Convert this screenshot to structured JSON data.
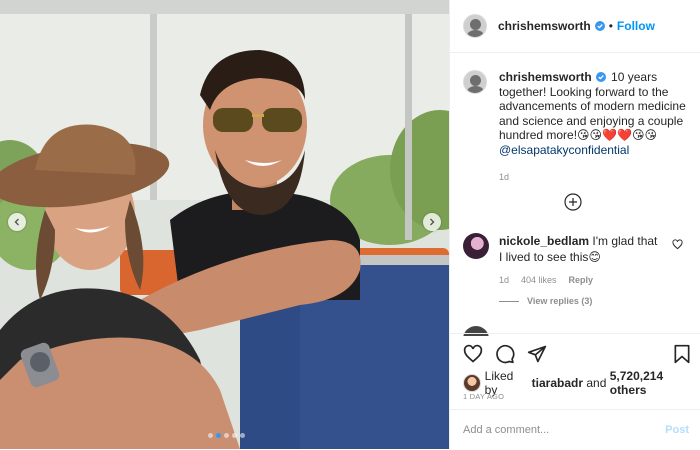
{
  "post": {
    "username": "chrishemsworth",
    "verified": true,
    "follow_separator": "•",
    "follow_label": "Follow"
  },
  "caption": {
    "username": "chrishemsworth",
    "text": "10 years together! Looking forward to the advancements of modern medicine and science and enjoying a couple hundred more!",
    "emojis": "😘😘❤️❤️😘😘",
    "mention": "@elsapatakyconfidential",
    "time": "1d"
  },
  "comments": [
    {
      "username": "nickole_bedlam",
      "text": "I'm glad that I lived to see this😊",
      "time": "1d",
      "likes": "404 likes",
      "reply_label": "Reply",
      "view_replies": "View replies (3)"
    }
  ],
  "likes": {
    "prefix": "Liked by",
    "first_liker": "tiarabadr",
    "conjunction": "and",
    "others": "5,720,214 others"
  },
  "date": "1 DAY AGO",
  "comment_input": {
    "placeholder": "Add a comment...",
    "post_label": "Post"
  },
  "carousel": {
    "total": 5,
    "active": 1
  },
  "colors": {
    "accent": "#0095f6",
    "verified": "#3897f0",
    "text": "#262626",
    "muted": "#8e8e8e"
  },
  "icons": [
    "chevron-left-icon",
    "chevron-right-icon",
    "verified-badge-icon",
    "plus-circle-icon",
    "heart-icon",
    "comment-icon",
    "share-icon",
    "bookmark-icon"
  ]
}
